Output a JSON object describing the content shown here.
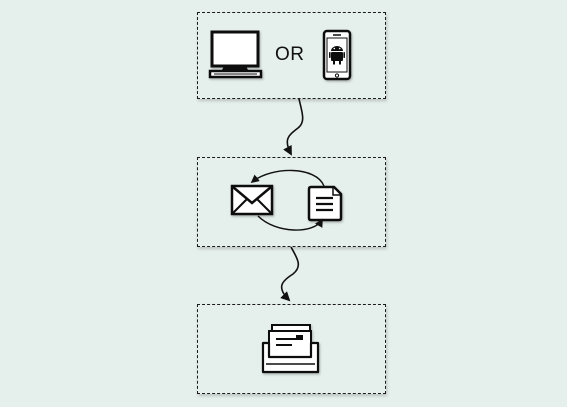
{
  "diagram": {
    "steps": [
      {
        "name": "device-choice",
        "icons": [
          "desktop-computer-icon",
          "android-phone-icon"
        ],
        "connector_text": "OR"
      },
      {
        "name": "message-exchange",
        "icons": [
          "envelope-icon",
          "document-icon"
        ]
      },
      {
        "name": "delivery",
        "icons": [
          "inbox-tray-icon"
        ]
      }
    ],
    "or_label": "OR",
    "colors": {
      "background": "#e5efeb",
      "stroke": "#1c1c1c",
      "icon_fill": "#ffffff"
    }
  }
}
